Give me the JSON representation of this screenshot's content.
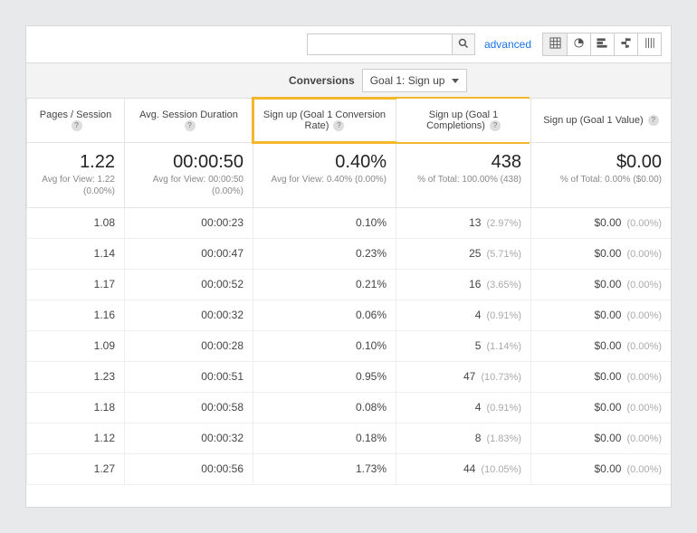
{
  "toolbar": {
    "search_placeholder": "",
    "advanced_label": "advanced"
  },
  "conversions": {
    "label": "Conversions",
    "goal_selected": "Goal 1: Sign up"
  },
  "columns": {
    "c1": "Pages / Session",
    "c2": "Avg. Session Duration",
    "c3": "Sign up (Goal 1 Conversion Rate)",
    "c4": "Sign up (Goal 1 Completions)",
    "c5": "Sign up (Goal 1 Value)"
  },
  "summary": {
    "pages": {
      "big": "1.22",
      "sub": "Avg for View: 1.22 (0.00%)"
    },
    "dur": {
      "big": "00:00:50",
      "sub": "Avg for View: 00:00:50 (0.00%)"
    },
    "rate": {
      "big": "0.40%",
      "sub": "Avg for View: 0.40% (0.00%)"
    },
    "comp": {
      "big": "438",
      "sub": "% of Total: 100.00% (438)"
    },
    "val": {
      "big": "$0.00",
      "sub": "% of Total: 0.00% ($0.00)"
    }
  },
  "rows": [
    {
      "pages": "1.08",
      "dur": "00:00:23",
      "rate": "0.10%",
      "comp": "13",
      "comp_pct": "(2.97%)",
      "val": "$0.00",
      "val_pct": "(0.00%)"
    },
    {
      "pages": "1.14",
      "dur": "00:00:47",
      "rate": "0.23%",
      "comp": "25",
      "comp_pct": "(5.71%)",
      "val": "$0.00",
      "val_pct": "(0.00%)"
    },
    {
      "pages": "1.17",
      "dur": "00:00:52",
      "rate": "0.21%",
      "comp": "16",
      "comp_pct": "(3.65%)",
      "val": "$0.00",
      "val_pct": "(0.00%)"
    },
    {
      "pages": "1.16",
      "dur": "00:00:32",
      "rate": "0.06%",
      "comp": "4",
      "comp_pct": "(0.91%)",
      "val": "$0.00",
      "val_pct": "(0.00%)"
    },
    {
      "pages": "1.09",
      "dur": "00:00:28",
      "rate": "0.10%",
      "comp": "5",
      "comp_pct": "(1.14%)",
      "val": "$0.00",
      "val_pct": "(0.00%)"
    },
    {
      "pages": "1.23",
      "dur": "00:00:51",
      "rate": "0.95%",
      "comp": "47",
      "comp_pct": "(10.73%)",
      "val": "$0.00",
      "val_pct": "(0.00%)"
    },
    {
      "pages": "1.18",
      "dur": "00:00:58",
      "rate": "0.08%",
      "comp": "4",
      "comp_pct": "(0.91%)",
      "val": "$0.00",
      "val_pct": "(0.00%)"
    },
    {
      "pages": "1.12",
      "dur": "00:00:32",
      "rate": "0.18%",
      "comp": "8",
      "comp_pct": "(1.83%)",
      "val": "$0.00",
      "val_pct": "(0.00%)"
    },
    {
      "pages": "1.27",
      "dur": "00:00:56",
      "rate": "1.73%",
      "comp": "44",
      "comp_pct": "(10.05%)",
      "val": "$0.00",
      "val_pct": "(0.00%)"
    }
  ]
}
